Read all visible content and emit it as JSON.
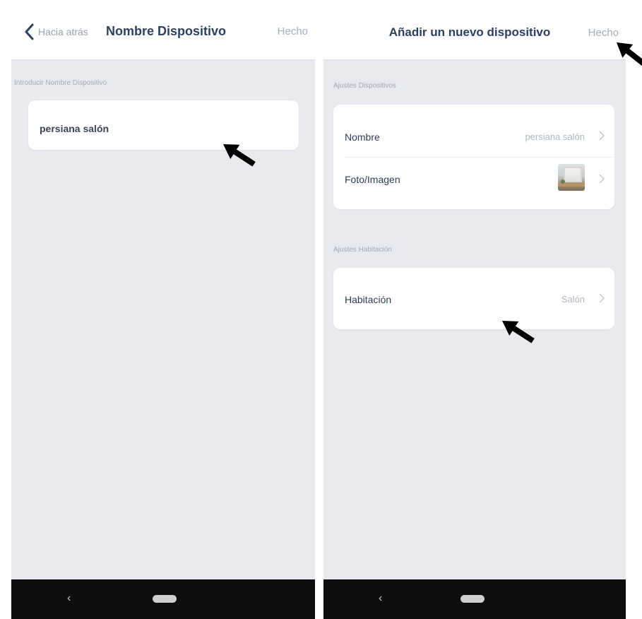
{
  "left_screen": {
    "back_label": "Hacia atrás",
    "title": "Nombre Dispositivo",
    "done_label": "Hecho",
    "section_label": "Introducir Nombre Dispositivo",
    "name_value": "persiana salón",
    "system_back_glyph": "‹"
  },
  "right_screen": {
    "title": "Añadir un nuevo dispositivo",
    "done_label": "Hecho",
    "device_section_label": "Ajustes Dispositivos",
    "device_rows": [
      {
        "label": "Nombre",
        "value": "persiana salón"
      },
      {
        "label": "Foto/Imagen",
        "value_icon": "window-photo-thumbnail"
      }
    ],
    "room_section_label": "Ajustes Habitación",
    "room_rows": [
      {
        "label": "Habitación",
        "value": "Salón"
      }
    ],
    "system_back_glyph": "‹"
  },
  "colors": {
    "background": "#e8eaef",
    "card": "#ffffff",
    "title": "#2d4060",
    "muted": "#a7b0bc",
    "nav_bar": "#0d0d0d",
    "annotation_arrow": "#000000"
  },
  "annotations": [
    "arrow-icon",
    "arrow-icon",
    "arrow-icon",
    "arrow-icon"
  ]
}
